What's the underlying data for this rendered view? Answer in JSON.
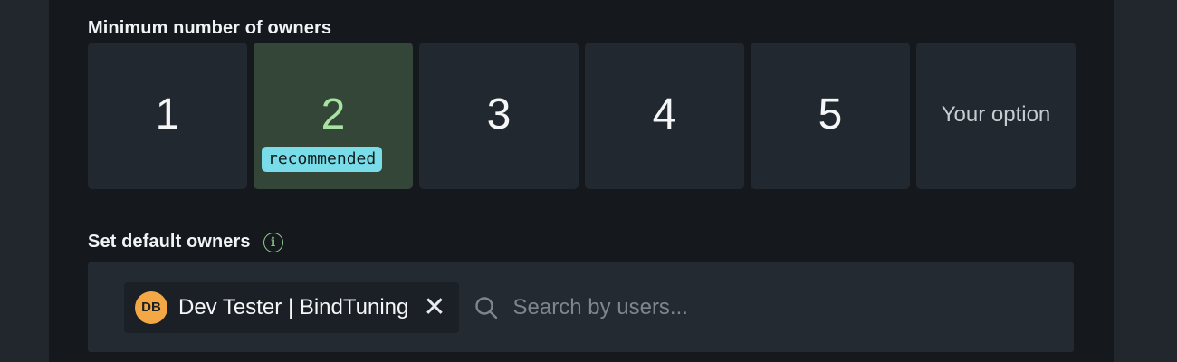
{
  "min_owners": {
    "title": "Minimum number of owners",
    "options": [
      {
        "label": "1"
      },
      {
        "label": "2",
        "badge": "recommended"
      },
      {
        "label": "3"
      },
      {
        "label": "4"
      },
      {
        "label": "5"
      },
      {
        "label": "Your option"
      }
    ],
    "selected_index": 1
  },
  "default_owners": {
    "title": "Set default owners",
    "info_icon": "info-icon",
    "chips": [
      {
        "initials": "DB",
        "name": "Dev Tester | BindTuning"
      }
    ],
    "search_placeholder": "Search by users..."
  },
  "colors": {
    "selected_bg": "#344637",
    "selected_text": "#a6e3a1",
    "badge_bg": "#79dde9",
    "avatar_bg": "#f3a845"
  }
}
